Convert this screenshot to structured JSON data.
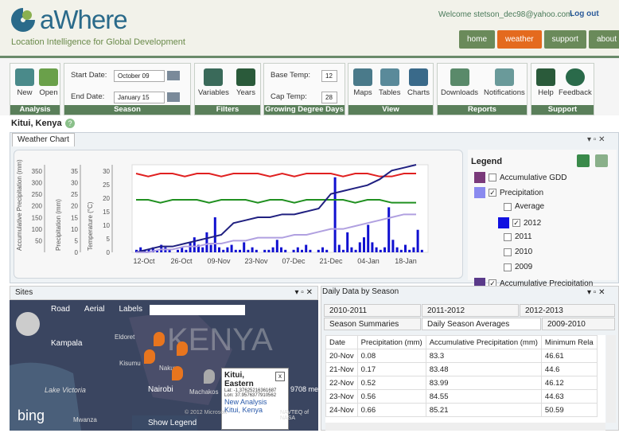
{
  "header": {
    "logo": "aWhere",
    "tagline": "Location Intelligence for Global Development",
    "welcome": "Welcome stetson_dec98@yahoo.com",
    "logout": "Log out",
    "nav": [
      "home",
      "weather",
      "support",
      "about"
    ],
    "active_nav": "weather"
  },
  "ribbon": {
    "analysis": {
      "title": "Analysis",
      "new": "New",
      "open": "Open"
    },
    "season": {
      "title": "Season",
      "start_label": "Start Date:",
      "start": "October 09",
      "end_label": "End Date:",
      "end": "January 15"
    },
    "filters": {
      "title": "Filters",
      "variables": "Variables",
      "years": "Years"
    },
    "gdd": {
      "title": "Growing Degree Days",
      "base_label": "Base Temp:",
      "base": "12",
      "cap_label": "Cap Temp:",
      "cap": "28"
    },
    "view": {
      "title": "View",
      "maps": "Maps",
      "tables": "Tables",
      "charts": "Charts"
    },
    "reports": {
      "title": "Reports",
      "downloads": "Downloads",
      "notifications": "Notifications"
    },
    "support": {
      "title": "Support",
      "help": "Help",
      "feedback": "Feedback"
    }
  },
  "location": "Kitui, Kenya",
  "weather_chart": {
    "tab": "Weather Chart",
    "legend_title": "Legend",
    "legend": [
      {
        "label": "Accumulative GDD",
        "color": "#7a3a7a",
        "checked": false
      },
      {
        "label": "Precipitation",
        "color": "#8a8aef",
        "checked": true
      },
      {
        "label": "Average",
        "checked": false
      },
      {
        "label": "2012",
        "color": "#1010e0",
        "checked": true
      },
      {
        "label": "2011",
        "checked": false
      },
      {
        "label": "2010",
        "checked": false
      },
      {
        "label": "2009",
        "checked": false
      },
      {
        "label": "Accumulative Precipitation",
        "color": "#5a3a8a",
        "checked": true
      }
    ]
  },
  "chart_data": {
    "type": "line",
    "x_ticks": [
      "12-Oct",
      "26-Oct",
      "09-Nov",
      "23-Nov",
      "07-Dec",
      "21-Dec",
      "04-Jan",
      "18-Jan"
    ],
    "axes": [
      {
        "label": "Accumulative Precipitation (mm)",
        "ticks": [
          50,
          100,
          150,
          200,
          250,
          300,
          350
        ]
      },
      {
        "label": "Precipitation (mm)",
        "ticks": [
          0,
          5,
          10,
          15,
          20,
          25,
          30,
          35
        ]
      },
      {
        "label": "Temperature (°C)",
        "ticks": [
          0,
          5,
          10,
          15,
          20,
          25,
          30
        ]
      }
    ],
    "series": [
      {
        "color": "#e02020",
        "values": [
          27,
          26,
          27,
          27,
          26,
          27,
          27,
          26,
          27,
          27,
          27,
          26,
          27,
          26,
          27,
          27,
          27,
          26,
          27,
          27,
          26,
          26,
          27,
          27
        ]
      },
      {
        "color": "#209020",
        "values": [
          18,
          18,
          17,
          18,
          18,
          18,
          17,
          18,
          18,
          18,
          17,
          18,
          18,
          17,
          18,
          18,
          18,
          18,
          17,
          18,
          18,
          17,
          17,
          17
        ]
      },
      {
        "color": "#202080",
        "values": [
          0,
          1,
          2,
          2,
          3,
          4,
          5,
          6,
          10,
          11,
          12,
          12,
          13,
          13,
          14,
          15,
          20,
          21,
          22,
          23,
          25,
          28,
          29,
          30
        ]
      },
      {
        "color": "#b0a0e0",
        "values": [
          0,
          0,
          1,
          1,
          2,
          2,
          3,
          3,
          4,
          4,
          5,
          5,
          5,
          6,
          6,
          7,
          8,
          8,
          9,
          10,
          11,
          12,
          13,
          13
        ]
      }
    ],
    "bars": [
      1,
      2,
      1,
      1,
      2,
      1,
      3,
      2,
      1,
      0,
      1,
      2,
      1,
      4,
      6,
      3,
      2,
      8,
      3,
      14,
      2,
      1,
      2,
      3,
      1,
      1,
      4,
      1,
      2,
      1,
      0,
      1,
      1,
      2,
      5,
      2,
      1,
      0,
      1,
      2,
      1,
      3,
      1,
      0,
      1,
      2,
      1,
      0,
      30,
      3,
      1,
      8,
      2,
      1,
      4,
      6,
      11,
      4,
      2,
      1,
      2,
      18,
      5,
      2,
      1,
      3,
      1,
      2,
      9,
      1
    ]
  },
  "sites": {
    "title": "Sites",
    "map_types": [
      "Road",
      "Aerial",
      "Labels"
    ],
    "places": [
      "Kampala",
      "Eldoret",
      "KENYA",
      "Lake Victoria",
      "Nairobi",
      "Machakos",
      "Kisumu",
      "Nakuru",
      "Mwanza"
    ],
    "popup": {
      "title": "Kitui, Eastern",
      "lat": "Lat: -1.37625216361687",
      "lon": "Lon: 37.9576377910562",
      "link": "New Analysis",
      "place": "Kitui, Kenya"
    },
    "show_legend": "Show Legend",
    "brand": "bing",
    "copyright": "© 2012 Microsoft",
    "navteq": "NAVTEQ of NASA",
    "scale": "9708 meters"
  },
  "daily": {
    "title": "Daily Data by Season",
    "season_tabs": [
      "2010-2011",
      "2011-2012",
      "2012-2013"
    ],
    "sub_tabs": [
      "Season Summaries",
      "Daily Season Averages",
      "2009-2010"
    ],
    "columns": [
      "Date",
      "Precipitation (mm)",
      "Accumulative Precipitation (mm)",
      "Minimum Rela"
    ],
    "rows": [
      [
        "20-Nov",
        "0.08",
        "83.3",
        "46.61"
      ],
      [
        "21-Nov",
        "0.17",
        "83.48",
        "44.6"
      ],
      [
        "22-Nov",
        "0.52",
        "83.99",
        "46.12"
      ],
      [
        "23-Nov",
        "0.56",
        "84.55",
        "44.63"
      ],
      [
        "24-Nov",
        "0.66",
        "85.21",
        "50.59"
      ]
    ]
  }
}
